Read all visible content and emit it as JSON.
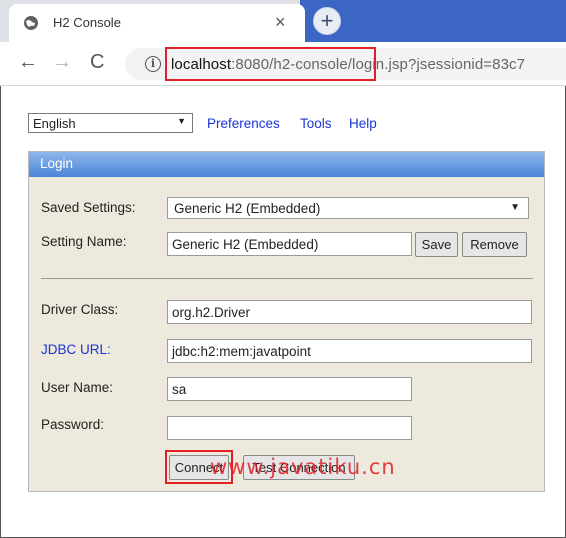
{
  "browser": {
    "tab_title": "H2 Console",
    "tab_close": "×",
    "new_tab": "+",
    "url_host": "localhost",
    "url_rest": ":8080/h2-console/login.jsp?jsessionid=83c7",
    "nav": {
      "back": "←",
      "forward": "→",
      "reload": "C",
      "info": "i"
    }
  },
  "top": {
    "language": "English",
    "links": [
      "Preferences",
      "Tools",
      "Help"
    ]
  },
  "login": {
    "header": "Login",
    "saved_settings_label": "Saved Settings:",
    "saved_settings_value": "Generic H2 (Embedded)",
    "setting_name_label": "Setting Name:",
    "setting_name_value": "Generic H2 (Embedded)",
    "save_button": "Save",
    "remove_button": "Remove",
    "driver_class_label": "Driver Class:",
    "driver_class_value": "org.h2.Driver",
    "jdbc_url_label": "JDBC URL:",
    "jdbc_url_value": "jdbc:h2:mem:javatpoint",
    "user_name_label": "User Name:",
    "user_name_value": "sa",
    "password_label": "Password:",
    "password_value": "",
    "connect_button": "Connect",
    "test_connection_button": "Test Connection"
  },
  "watermark": "www.javatiku.cn",
  "colors": {
    "highlight": "#e01f26",
    "link": "#1a35d6",
    "panel_header": "#4a86d8",
    "panel_bg": "#ede9dc"
  }
}
